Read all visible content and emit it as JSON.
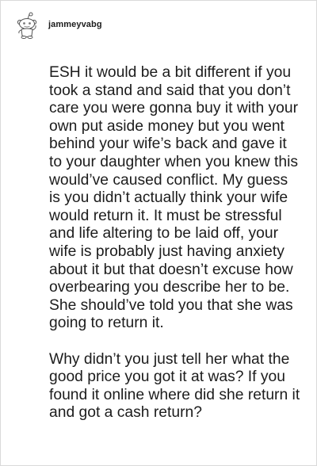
{
  "comment": {
    "username": "jammeyvabg",
    "avatar_icon": "reddit-snoo-avatar-icon",
    "paragraphs": [
      "ESH it would be a bit different if you took a stand and said that you don’t care you were gonna buy it with your own put aside money but you went behind your wife’s back and gave it to your daughter when you knew this would’ve caused conflict. My guess is you didn’t actually think your wife would return it. It must be stressful and life altering to be laid off, your wife is probably just having anxiety about it but that doesn’t excuse how overbearing you describe her to be. She should’ve told you that she was going to return it.",
      "Why didn’t you just tell her what the good price you got it at was? If you found it online where did she return it and got a cash return?"
    ]
  },
  "colors": {
    "text": "#1c1c1c",
    "border": "#dadada",
    "background": "#ffffff"
  }
}
